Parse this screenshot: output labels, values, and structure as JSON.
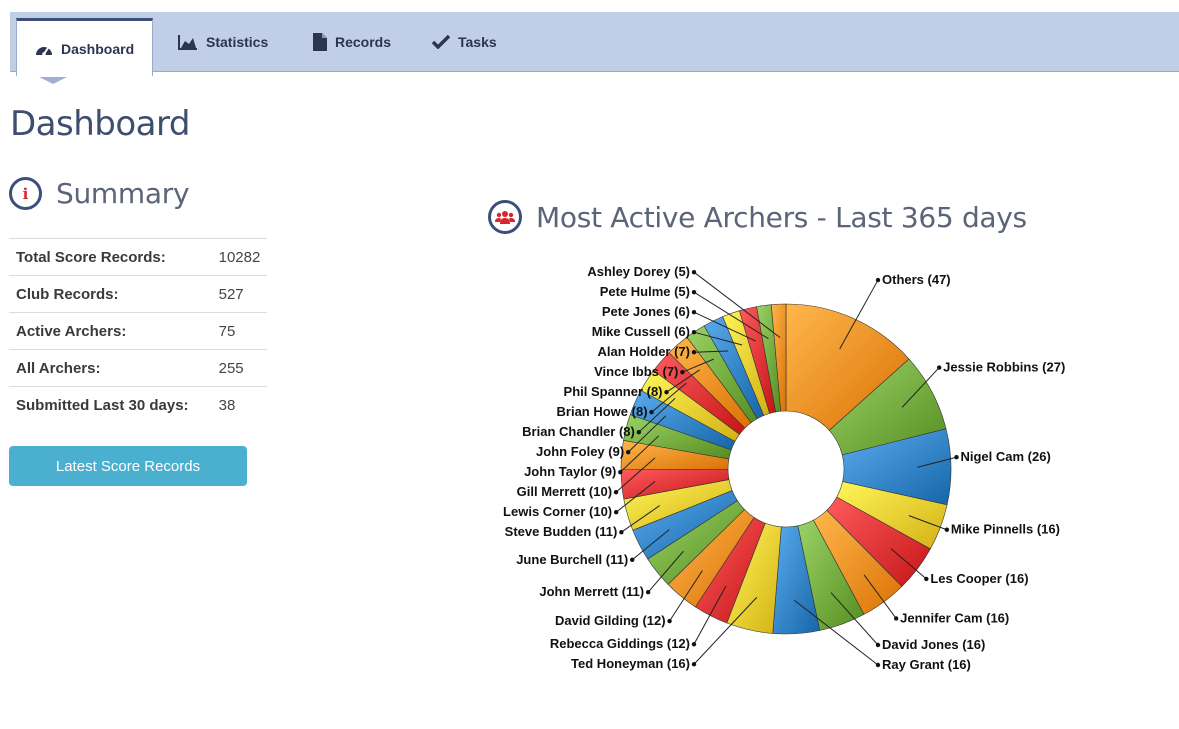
{
  "tabs": [
    {
      "label": "Dashboard",
      "icon": "dashboard-gauge-icon",
      "active": true
    },
    {
      "label": "Statistics",
      "icon": "area-chart-icon",
      "active": false
    },
    {
      "label": "Records",
      "icon": "file-icon",
      "active": false
    },
    {
      "label": "Tasks",
      "icon": "check-icon",
      "active": false
    }
  ],
  "page": {
    "title": "Dashboard"
  },
  "summary": {
    "title": "Summary",
    "icon": "info-icon",
    "rows": [
      {
        "label": "Total Score Records:",
        "value": "10282"
      },
      {
        "label": "Club Records:",
        "value": "527"
      },
      {
        "label": "Active Archers:",
        "value": "75"
      },
      {
        "label": "All Archers:",
        "value": "255"
      },
      {
        "label": "Submitted Last 30 days:",
        "value": "38"
      }
    ],
    "button_label": "Latest Score Records"
  },
  "chart_section": {
    "title": "Most Active Archers - Last 365 days",
    "icon": "users-icon"
  },
  "colors": {
    "accent": "#3d4e7c",
    "tab_bar": "#c0cee6",
    "button": "#4bb0d0",
    "palette": {
      "orange": "#f48a1e",
      "green": "#6ea63a",
      "blue": "#2e7fc1",
      "yellow": "#ecc92c",
      "red": "#de2e30"
    }
  },
  "chart_data": {
    "type": "pie",
    "donut": true,
    "title": "",
    "slices": [
      {
        "label": "Others (47)",
        "value": 47,
        "color": "orange"
      },
      {
        "label": "Jessie Robbins (27)",
        "value": 27,
        "color": "green"
      },
      {
        "label": "Nigel Cam (26)",
        "value": 26,
        "color": "blue"
      },
      {
        "label": "Mike Pinnells (16)",
        "value": 16,
        "color": "yellow"
      },
      {
        "label": "Les Cooper (16)",
        "value": 16,
        "color": "red"
      },
      {
        "label": "Jennifer Cam (16)",
        "value": 16,
        "color": "orange"
      },
      {
        "label": "David Jones (16)",
        "value": 16,
        "color": "green"
      },
      {
        "label": "Ray Grant (16)",
        "value": 16,
        "color": "blue"
      },
      {
        "label": "Ted Honeyman (16)",
        "value": 16,
        "color": "yellow"
      },
      {
        "label": "Rebecca Giddings (12)",
        "value": 12,
        "color": "red"
      },
      {
        "label": "David Gilding (12)",
        "value": 12,
        "color": "orange"
      },
      {
        "label": "John Merrett (11)",
        "value": 11,
        "color": "green"
      },
      {
        "label": "June Burchell (11)",
        "value": 11,
        "color": "blue"
      },
      {
        "label": "Steve Budden (11)",
        "value": 11,
        "color": "yellow"
      },
      {
        "label": "Lewis Corner (10)",
        "value": 10,
        "color": "red"
      },
      {
        "label": "Gill Merrett (10)",
        "value": 10,
        "color": "orange"
      },
      {
        "label": "John Taylor (9)",
        "value": 9,
        "color": "green"
      },
      {
        "label": "John Foley (9)",
        "value": 9,
        "color": "blue"
      },
      {
        "label": "Brian Chandler (8)",
        "value": 8,
        "color": "yellow"
      },
      {
        "label": "Brian Howe (8)",
        "value": 8,
        "color": "red"
      },
      {
        "label": "Phil Spanner (8)",
        "value": 8,
        "color": "orange"
      },
      {
        "label": "Vince Ibbs (7)",
        "value": 7,
        "color": "green"
      },
      {
        "label": "Alan Holder (7)",
        "value": 7,
        "color": "blue"
      },
      {
        "label": "Mike Cussell (6)",
        "value": 6,
        "color": "yellow"
      },
      {
        "label": "Pete Jones (6)",
        "value": 6,
        "color": "red"
      },
      {
        "label": "Pete Hulme (5)",
        "value": 5,
        "color": "green"
      },
      {
        "label": "Ashley Dorey (5)",
        "value": 5,
        "color": "orange"
      }
    ]
  }
}
